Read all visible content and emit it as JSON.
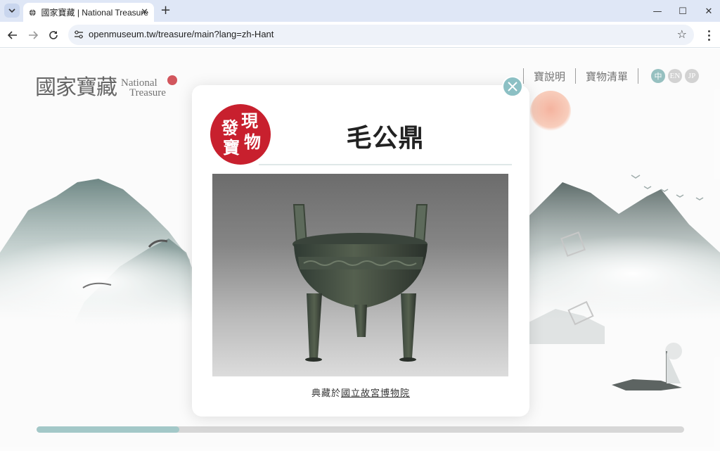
{
  "browser": {
    "tab_title": "國家寶藏 | National Treasure",
    "tab_close": "✕",
    "new_tab": "+",
    "url": "openmuseum.tw/treasure/main?lang=zh-Hant",
    "window_controls": {
      "minimize": "—",
      "maximize": "☐",
      "close": "✕"
    }
  },
  "site": {
    "logo_cn": "國家寶藏",
    "logo_en_line1": "National",
    "logo_en_line2": "Treasure",
    "nav": [
      {
        "label": "寶說明"
      },
      {
        "label": "寶物清單"
      }
    ],
    "languages": [
      {
        "label": "中",
        "active": true
      },
      {
        "label": "EN",
        "active": false
      },
      {
        "label": "JP",
        "active": false
      }
    ],
    "progress": 0.22,
    "accent": "#8fbcbc"
  },
  "modal": {
    "seal_chars": [
      "現",
      "發",
      "物",
      "寶"
    ],
    "treasure_name": "毛公鼎",
    "credit_prefix": "典藏於",
    "credit_museum": "國立故宮博物院",
    "seal_color": "#c8202e",
    "close_icon": "close-icon"
  }
}
